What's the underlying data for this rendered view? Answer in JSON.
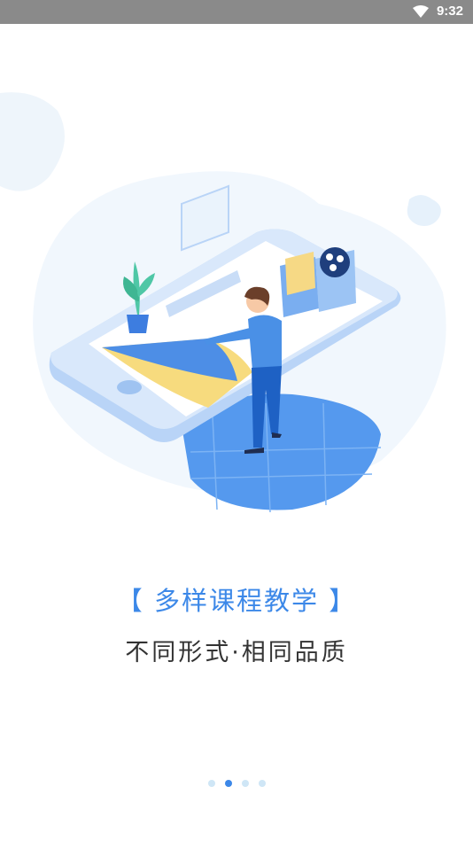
{
  "status_bar": {
    "time": "9:32",
    "icon": "wifi-icon"
  },
  "onboarding": {
    "title": "【 多样课程教学 】",
    "subtitle": "不同形式·相同品质",
    "page_count": 4,
    "active_page_index": 1
  },
  "colors": {
    "accent": "#3c88e8",
    "dot_inactive": "#cfe6f6",
    "status_bar": "#8a8a8a"
  }
}
